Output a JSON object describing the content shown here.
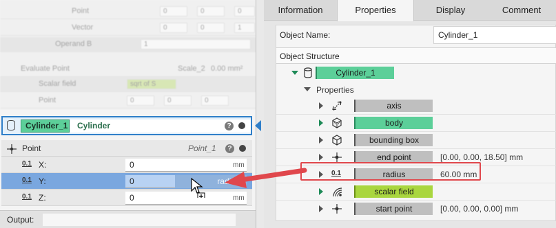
{
  "left_panel": {
    "faded_rows": [
      {
        "label": "Point",
        "values": [
          "0",
          "0",
          "0"
        ]
      },
      {
        "label": "Vector",
        "values": [
          "0",
          "0",
          "1"
        ]
      },
      {
        "label": "Operand B",
        "values": [
          "1"
        ]
      },
      {
        "label": "Evaluate Point",
        "values": [
          "Scale_2",
          "0.00 mm²"
        ]
      },
      {
        "label": "Scalar field",
        "values": [
          "sqrt of S"
        ]
      },
      {
        "label": "Point",
        "values": [
          "0",
          "0",
          "0"
        ]
      }
    ],
    "node": {
      "name": "Cylinder_1",
      "type": "Cylinder",
      "help": "?"
    },
    "point_block": {
      "label": "Point",
      "point_name": "Point_1",
      "help": "?",
      "rows": [
        {
          "symbol": "0.1",
          "axis": "X:",
          "value": "0",
          "unit": "mm"
        },
        {
          "symbol": "0.1",
          "axis": "Y:",
          "value": "0",
          "unit": "",
          "tag": "radius"
        },
        {
          "symbol": "0.1",
          "axis": "Z:",
          "value": "0",
          "unit": "mm"
        }
      ]
    },
    "output_label": "Output:"
  },
  "right_panel": {
    "tabs": [
      {
        "label": "Information",
        "active": false
      },
      {
        "label": "Properties",
        "active": true
      },
      {
        "label": "Display",
        "active": false
      },
      {
        "label": "Comment",
        "active": false
      }
    ],
    "object_name_label": "Object Name:",
    "object_name_value": "Cylinder_1",
    "structure_header": "Object Structure",
    "root_item": "Cylinder_1",
    "properties_label": "Properties",
    "items": [
      {
        "label": "axis",
        "value": "",
        "icon": "axis-icon",
        "style": "gray"
      },
      {
        "label": "body",
        "value": "",
        "icon": "body-icon",
        "style": "green"
      },
      {
        "label": "bounding box",
        "value": "",
        "icon": "bounding-box-icon",
        "style": "gray"
      },
      {
        "label": "end point",
        "value": "[0.00, 0.00, 18.50] mm",
        "icon": "point-icon",
        "style": "gray"
      },
      {
        "label": "radius",
        "value": "60.00 mm",
        "icon": "scalar-icon",
        "style": "gray"
      },
      {
        "label": "scalar field",
        "value": "",
        "icon": "scalar-field-icon",
        "style": "green"
      },
      {
        "label": "start point",
        "value": "[0.00, 0.00, 0.00] mm",
        "icon": "point-icon",
        "style": "gray"
      }
    ]
  },
  "colors": {
    "accent_blue": "#2f7fc9",
    "node_green": "#5ccf99",
    "highlight_red": "#e0474c",
    "selected_row": "#7aa7df"
  }
}
